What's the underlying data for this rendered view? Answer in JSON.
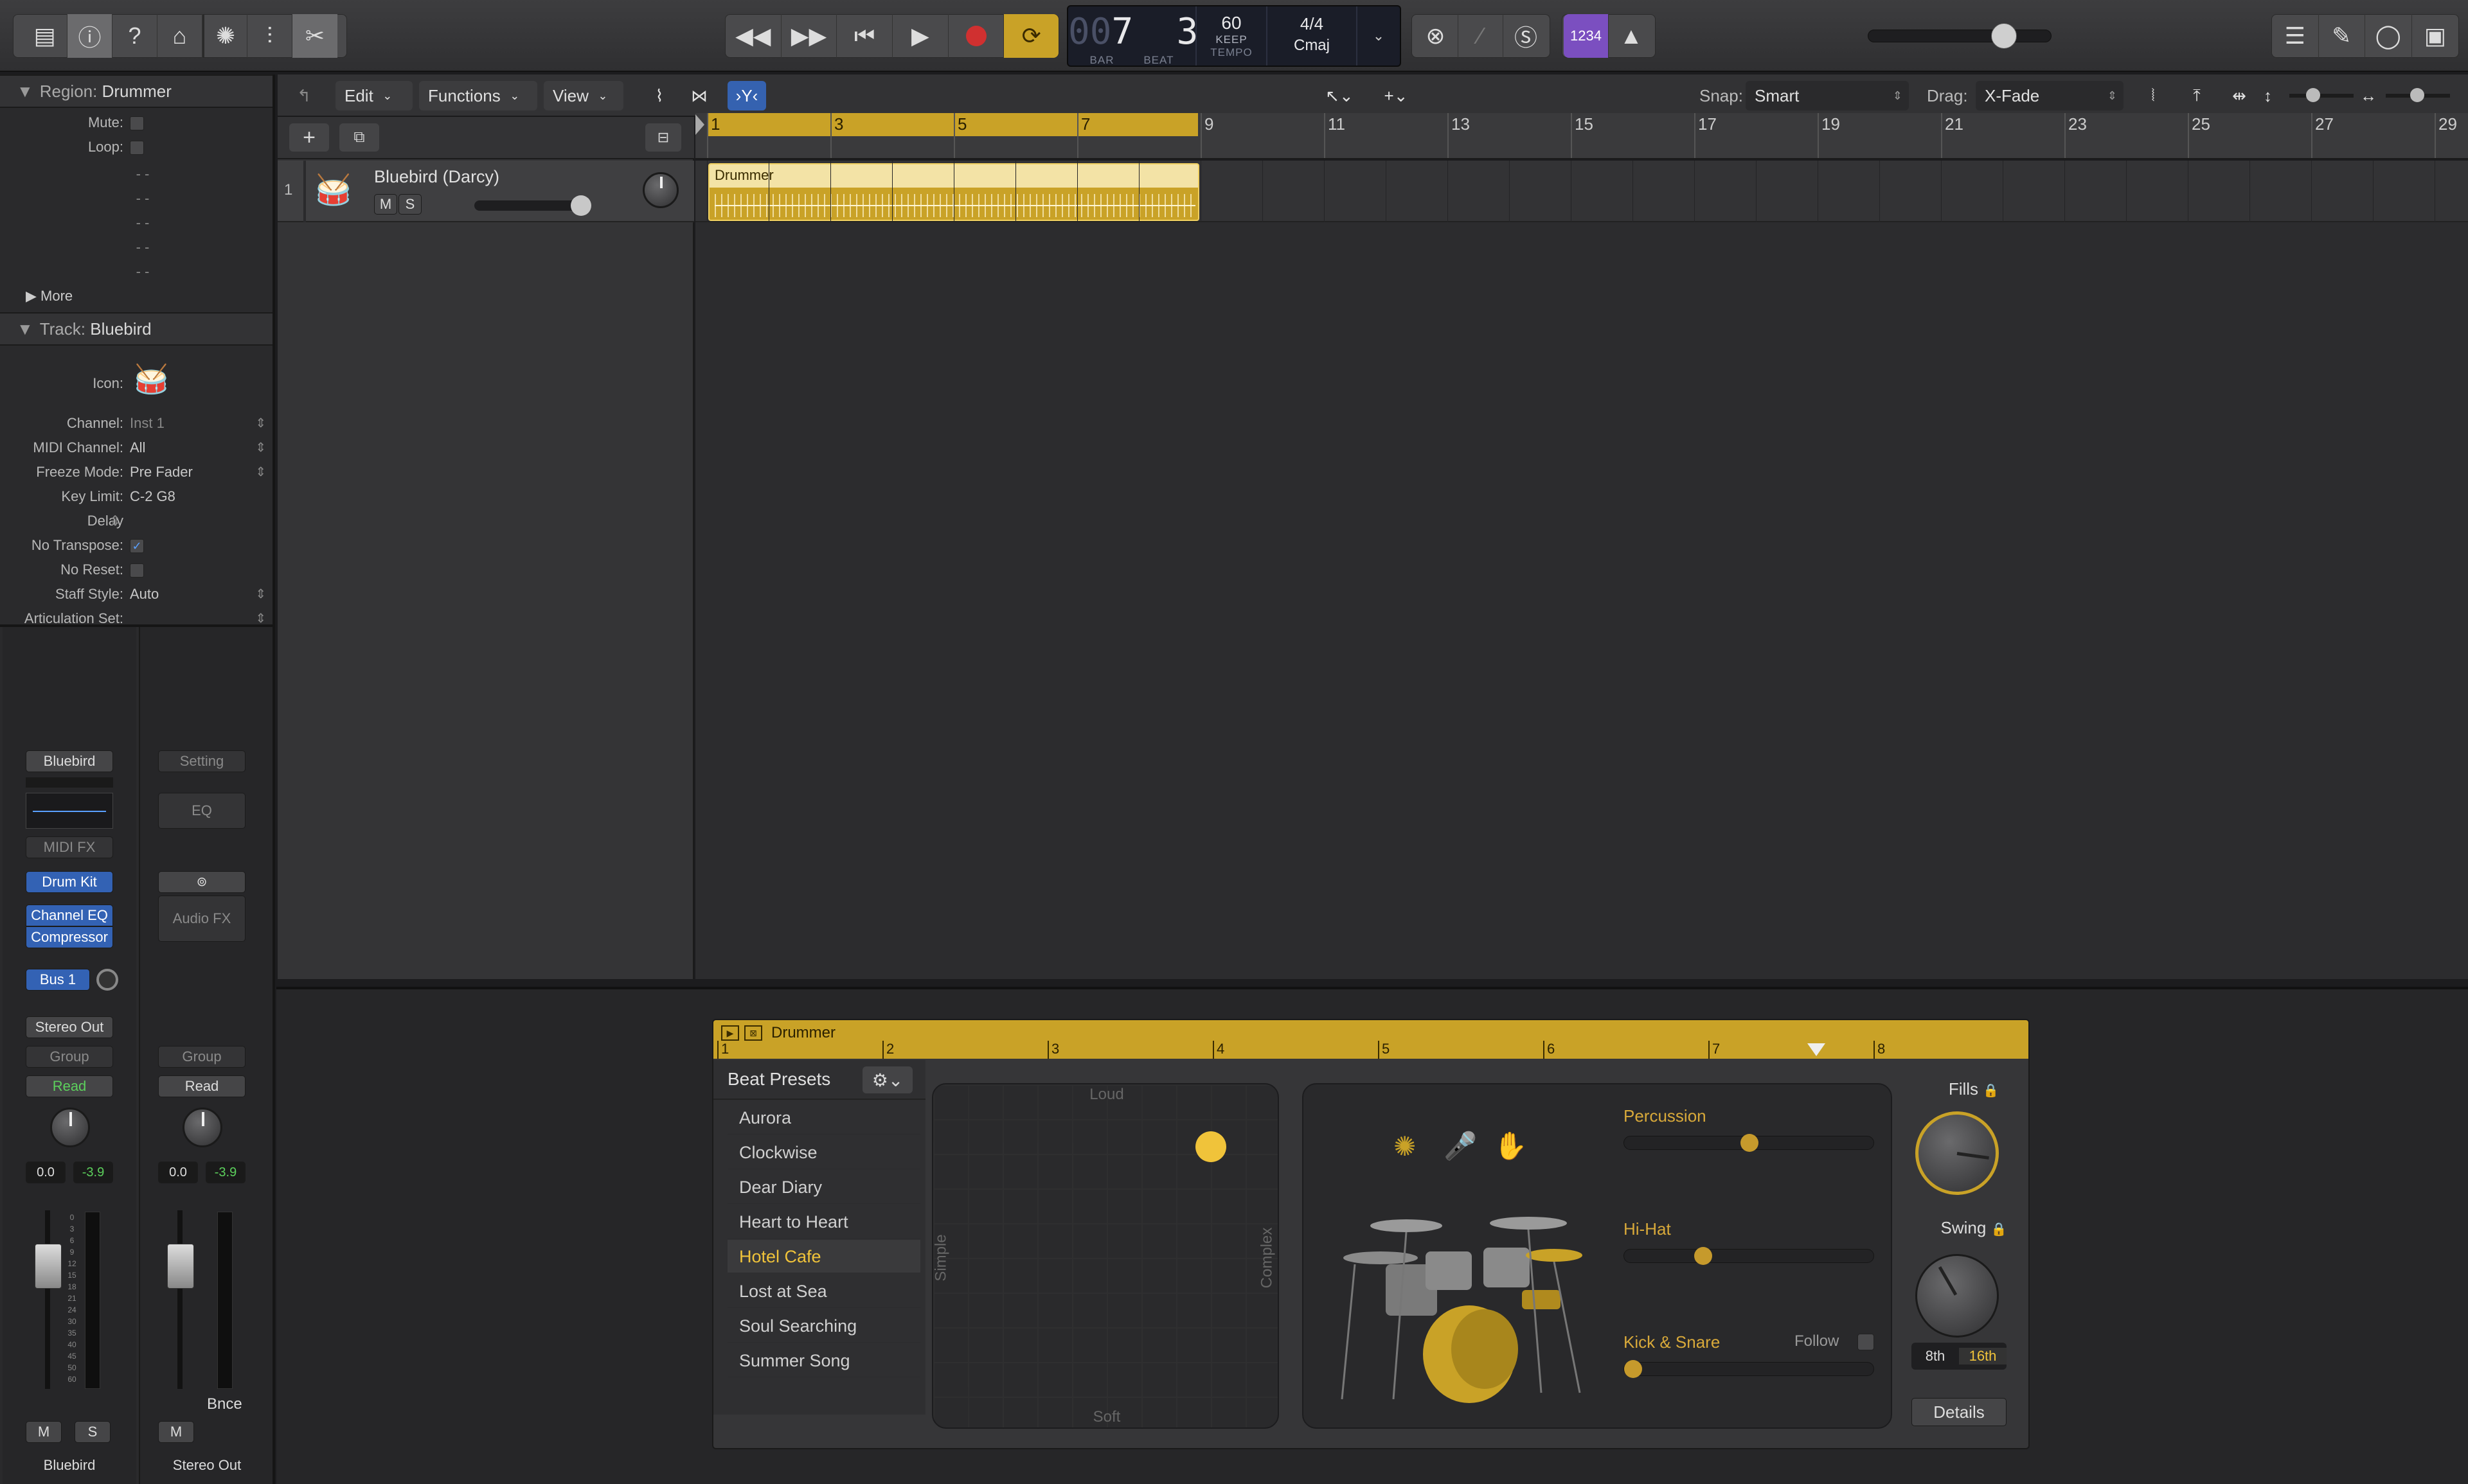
{
  "toolbar": {
    "lcd": {
      "bar_dim": "00",
      "bar": "7",
      "beat": "3",
      "bar_label": "BAR",
      "beat_label": "BEAT",
      "tempo": "60",
      "tempo_mode": "KEEP",
      "tempo_label": "TEMPO",
      "signature": "4/4",
      "key": "Cmaj"
    },
    "count_in_label": "1234",
    "accent_purple": "#7b4fc0",
    "accent_gold": "#c9a227",
    "record_color": "#d03030"
  },
  "inspector": {
    "region_title": "Region:",
    "region_name": "Drummer",
    "region_rows": [
      {
        "label": "Mute:"
      },
      {
        "label": "Loop:"
      }
    ],
    "dashes": [
      "- -",
      "- -",
      "- -",
      "- -",
      "- -"
    ],
    "more_label": "More",
    "track_title": "Track:",
    "track_name": "Bluebird",
    "icon_label": "Icon:",
    "track_rows": [
      {
        "label": "Channel:",
        "value": "Inst 1"
      },
      {
        "label": "MIDI Channel:",
        "value": "All"
      },
      {
        "label": "Freeze Mode:",
        "value": "Pre Fader"
      },
      {
        "label": "Key Limit:",
        "value": "C-2  G8"
      },
      {
        "label": "Delay",
        "value": ""
      },
      {
        "label": "No Transpose:",
        "value": "✓"
      },
      {
        "label": "No Reset:",
        "value": ""
      },
      {
        "label": "Staff Style:",
        "value": "Auto"
      },
      {
        "label": "Articulation Set:",
        "value": ""
      }
    ]
  },
  "mixer": {
    "left": {
      "setting": "Bluebird",
      "midi_fx": "MIDI FX",
      "instrument": "Drum Kit",
      "fx1": "Channel EQ",
      "fx2": "Compressor",
      "send": "Bus 1",
      "output": "Stereo Out",
      "group": "Group",
      "automation": "Read",
      "pan": "0.0",
      "level": "-3.9",
      "scale": [
        "0",
        "3",
        "6",
        "9",
        "12",
        "15",
        "18",
        "21",
        "24",
        "30",
        "35",
        "40",
        "45",
        "50",
        "60"
      ],
      "mute": "M",
      "solo": "S",
      "name": "Bluebird"
    },
    "right": {
      "setting": "Setting",
      "eq": "EQ",
      "audio_fx": "Audio FX",
      "group": "Group",
      "automation": "Read",
      "pan": "0.0",
      "level": "-3.9",
      "bounce": "Bnce",
      "mute": "M",
      "name": "Stereo Out"
    }
  },
  "tracks": {
    "menus": [
      "Edit",
      "Functions",
      "View"
    ],
    "snap_label": "Snap:",
    "snap_value": "Smart",
    "drag_label": "Drag:",
    "drag_value": "X-Fade",
    "ruler": [
      "1",
      "3",
      "5",
      "7",
      "9",
      "11",
      "13",
      "15",
      "17",
      "19",
      "21",
      "23",
      "25",
      "27",
      "29"
    ],
    "track": {
      "number": "1",
      "name": "Bluebird (Darcy)",
      "mute": "M",
      "solo": "S"
    },
    "region": {
      "name": "Drummer"
    }
  },
  "drummer": {
    "title": "Drummer",
    "ruler": [
      "1",
      "2",
      "3",
      "4",
      "5",
      "6",
      "7",
      "8"
    ],
    "presets_title": "Beat Presets",
    "presets": [
      "Aurora",
      "Clockwise",
      "Dear Diary",
      "Heart to Heart",
      "Hotel Cafe",
      "Lost at Sea",
      "Soul Searching",
      "Summer Song"
    ],
    "selected_preset": "Hotel Cafe",
    "xy": {
      "loud": "Loud",
      "soft": "Soft",
      "simple": "Simple",
      "complex": "Complex",
      "complexity": 0.8,
      "loudness": 0.82
    },
    "percussion_label": "Percussion",
    "percussion_value": 0.5,
    "hihat_label": "Hi-Hat",
    "hihat_value": 0.3,
    "kick_label": "Kick & Snare",
    "kick_value": 0.0,
    "follow_label": "Follow",
    "fills_label": "Fills",
    "swing_label": "Swing",
    "eighth_label": "8th",
    "sixteenth_label": "16th",
    "details_label": "Details"
  }
}
